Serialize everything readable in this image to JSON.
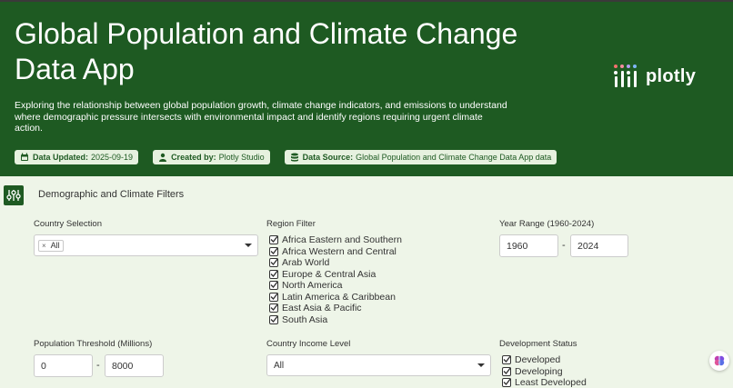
{
  "header": {
    "title": "Global Population and Climate Change Data App",
    "description": "Exploring the relationship between global population growth, climate change indicators, and emissions to understand where demographic pressure intersects with environmental impact and identify regions requiring urgent climate action.",
    "logo_text": "plotly",
    "badges": [
      {
        "key": "Data Updated:",
        "value": "2025-09-19",
        "icon": "calendar-icon"
      },
      {
        "key": "Created by:",
        "value": "Plotly Studio",
        "icon": "user-icon"
      },
      {
        "key": "Data Source:",
        "value": "Global Population and Climate Change Data App data",
        "icon": "database-icon"
      }
    ]
  },
  "filters": {
    "title": "Demographic and Climate Filters",
    "country": {
      "label": "Country Selection",
      "selected": "All"
    },
    "region": {
      "label": "Region Filter",
      "options": [
        "Africa Eastern and Southern",
        "Africa Western and Central",
        "Arab World",
        "Europe & Central Asia",
        "North America",
        "Latin America & Caribbean",
        "East Asia & Pacific",
        "South Asia"
      ]
    },
    "year_range": {
      "label": "Year Range (1960-2024)",
      "from": "1960",
      "to": "2024",
      "separator": "-"
    },
    "population": {
      "label": "Population Threshold (Millions)",
      "min": "0",
      "max": "8000",
      "separator": "-"
    },
    "income": {
      "label": "Country Income Level",
      "selected": "All"
    },
    "development": {
      "label": "Development Status",
      "options": [
        "Developed",
        "Developing",
        "Least Developed"
      ]
    }
  },
  "colors": {
    "header_bg": "#1e5a22",
    "page_bg": "#eef5e8",
    "badge_bg": "#e6f1df"
  }
}
